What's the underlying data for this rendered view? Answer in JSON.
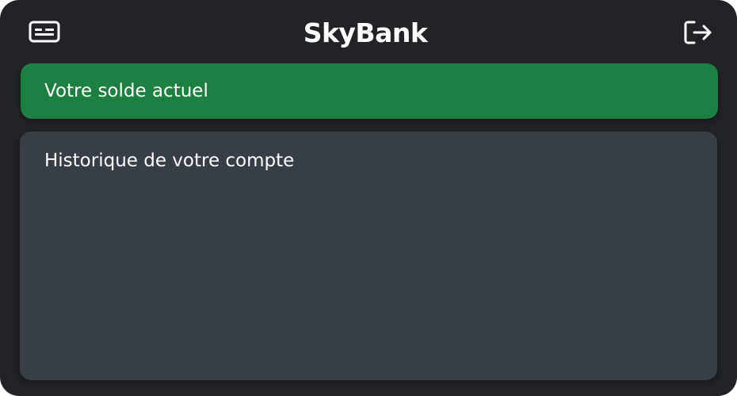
{
  "app": {
    "title": "SkyBank"
  },
  "header": {
    "left_icon": "id-card-icon",
    "right_icon": "logout-icon"
  },
  "balance": {
    "label": "Votre solde actuel"
  },
  "history": {
    "label": "Historique de votre compte"
  },
  "colors": {
    "background": "#212327",
    "balance_card": "#1c8042",
    "history_card": "#383e45",
    "text": "#ffffff"
  }
}
